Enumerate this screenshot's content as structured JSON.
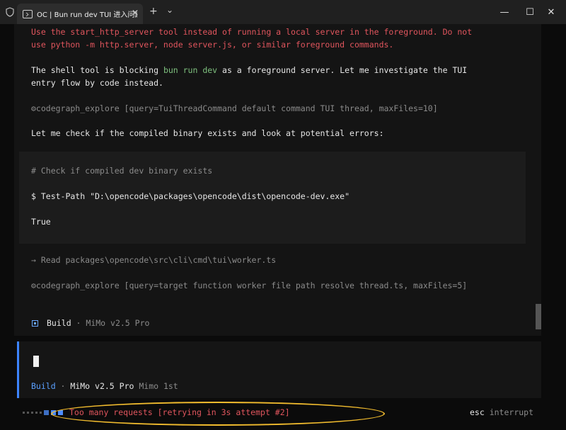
{
  "window": {
    "tab_title": "OC | Bun run dev TUI 进入问题",
    "close_glyph": "✕",
    "new_tab_glyph": "+",
    "dropdown_glyph": "⌄",
    "minimize_glyph": "—",
    "maximize_glyph": "☐",
    "window_close_glyph": "✕"
  },
  "messages": {
    "warning_line1": "Use the start_http_server tool instead of running a local server in the foreground. Do not",
    "warning_line2": "use python -m http.server, node server.js, or similar foreground commands.",
    "assistant_line1_a": "The shell tool is blocking ",
    "assistant_line1_code": "bun run dev",
    "assistant_line1_b": " as a foreground server. Let me investigate the TUI",
    "assistant_line2": "entry flow by code instead.",
    "tool1": "⚙codegraph_explore [query=TuiThreadCommand default command TUI thread, maxFiles=10]",
    "check_text": "Let me check if the compiled binary exists and look at potential errors:",
    "code_comment": "# Check if compiled dev binary exists",
    "code_command": "$ Test-Path \"D:\\opencode\\packages\\opencode\\dist\\opencode-dev.exe\"",
    "code_output": "True",
    "read_line": "→ Read packages\\opencode\\src\\cli\\cmd\\tui\\worker.ts",
    "tool2": "⚙codegraph_explore [query=target function worker file path resolve thread.ts, maxFiles=5]",
    "build_agent": "Build",
    "build_sep": " · ",
    "build_model": "MiMo v2.5 Pro"
  },
  "input": {
    "agent": "Build",
    "sep": " · ",
    "model": "MiMo v2.5 Pro",
    "provider": " Mimo 1st"
  },
  "status": {
    "message": "Too many requests [retrying in 3s attempt #2]",
    "esc_key": "esc",
    "esc_action": " interrupt"
  },
  "colors": {
    "error_red": "#e0555d",
    "accent_blue": "#3d84ff",
    "highlight_yellow": "#f2bc2e"
  }
}
